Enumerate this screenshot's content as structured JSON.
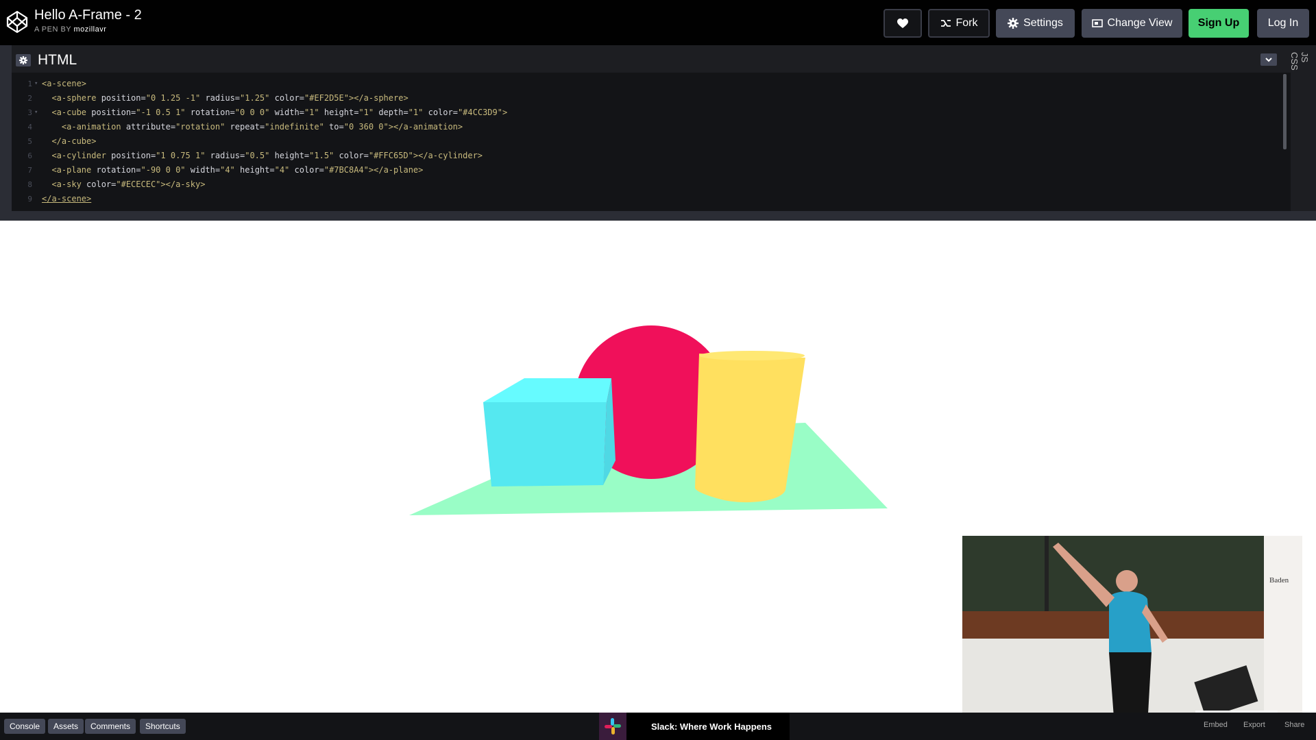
{
  "header": {
    "title": "Hello A-Frame - 2",
    "byline_prefix": "A PEN BY",
    "author": "mozillavr",
    "buttons": {
      "fork": "Fork",
      "settings": "Settings",
      "change_view": "Change View",
      "sign_up": "Sign Up",
      "log_in": "Log In"
    }
  },
  "editor": {
    "panel_title": "HTML",
    "side_tabs": [
      "JS",
      "CSS"
    ],
    "lines": [
      {
        "num": "1",
        "fold": "▾",
        "parts": [
          [
            "tag",
            "<a-scene>"
          ]
        ]
      },
      {
        "num": "2",
        "fold": "",
        "parts": [
          [
            "tag",
            "  <a-sphere"
          ],
          [
            "attr",
            " position="
          ],
          [
            "str",
            "\"0 1.25 -1\""
          ],
          [
            "attr",
            " radius="
          ],
          [
            "str",
            "\"1.25\""
          ],
          [
            "attr",
            " color="
          ],
          [
            "str",
            "\"#EF2D5E\""
          ],
          [
            "tag",
            "></a-sphere>"
          ]
        ]
      },
      {
        "num": "3",
        "fold": "▾",
        "parts": [
          [
            "tag",
            "  <a-cube"
          ],
          [
            "attr",
            " position="
          ],
          [
            "str",
            "\"-1 0.5 1\""
          ],
          [
            "attr",
            " rotation="
          ],
          [
            "str",
            "\"0 0 0\""
          ],
          [
            "attr",
            " width="
          ],
          [
            "str",
            "\"1\""
          ],
          [
            "attr",
            " height="
          ],
          [
            "str",
            "\"1\""
          ],
          [
            "attr",
            " depth="
          ],
          [
            "str",
            "\"1\""
          ],
          [
            "attr",
            " color="
          ],
          [
            "str",
            "\"#4CC3D9\""
          ],
          [
            "tag",
            ">"
          ]
        ]
      },
      {
        "num": "4",
        "fold": "",
        "parts": [
          [
            "tag",
            "    <a-animation"
          ],
          [
            "attr",
            " attribute="
          ],
          [
            "str",
            "\"rotation\""
          ],
          [
            "attr",
            " repeat="
          ],
          [
            "str",
            "\"indefinite\""
          ],
          [
            "attr",
            " to="
          ],
          [
            "str",
            "\"0 360 0\""
          ],
          [
            "tag",
            "></a-animation>"
          ]
        ]
      },
      {
        "num": "5",
        "fold": "",
        "parts": [
          [
            "tag",
            "  </a-cube>"
          ]
        ]
      },
      {
        "num": "6",
        "fold": "",
        "parts": [
          [
            "tag",
            "  <a-cylinder"
          ],
          [
            "attr",
            " position="
          ],
          [
            "str",
            "\"1 0.75 1\""
          ],
          [
            "attr",
            " radius="
          ],
          [
            "str",
            "\"0.5\""
          ],
          [
            "attr",
            " height="
          ],
          [
            "str",
            "\"1.5\""
          ],
          [
            "attr",
            " color="
          ],
          [
            "str",
            "\"#FFC65D\""
          ],
          [
            "tag",
            "></a-cylinder>"
          ]
        ]
      },
      {
        "num": "7",
        "fold": "",
        "parts": [
          [
            "tag",
            "  <a-plane"
          ],
          [
            "attr",
            " rotation="
          ],
          [
            "str",
            "\"-90 0 0\""
          ],
          [
            "attr",
            " width="
          ],
          [
            "str",
            "\"4\""
          ],
          [
            "attr",
            " height="
          ],
          [
            "str",
            "\"4\""
          ],
          [
            "attr",
            " color="
          ],
          [
            "str",
            "\"#7BC8A4\""
          ],
          [
            "tag",
            "></a-plane>"
          ]
        ]
      },
      {
        "num": "8",
        "fold": "",
        "parts": [
          [
            "tag",
            "  <a-sky"
          ],
          [
            "attr",
            " color="
          ],
          [
            "str",
            "\"#ECECEC\""
          ],
          [
            "tag",
            "></a-sky>"
          ]
        ]
      },
      {
        "num": "9",
        "fold": "",
        "parts": [
          [
            "tag",
            "</a-scene>"
          ]
        ]
      }
    ]
  },
  "preview": {
    "colors": {
      "sphere": "#f0105a",
      "cube_front": "#55e8f0",
      "cube_top": "#66fbff",
      "cube_side": "#4fd8e4",
      "cylinder": "#ffe05f",
      "cylinder_top": "#ffe873",
      "plane": "#99fdc6"
    }
  },
  "footer": {
    "buttons": [
      "Console",
      "Assets",
      "Comments",
      "Shortcuts"
    ],
    "ad_text": "Slack: Where Work Happens",
    "right_links": [
      "Embed",
      "Export",
      "Share"
    ]
  },
  "theme": {
    "accent_green": "#47cf73",
    "header_bg": "#010101",
    "editor_bg": "#131417"
  }
}
